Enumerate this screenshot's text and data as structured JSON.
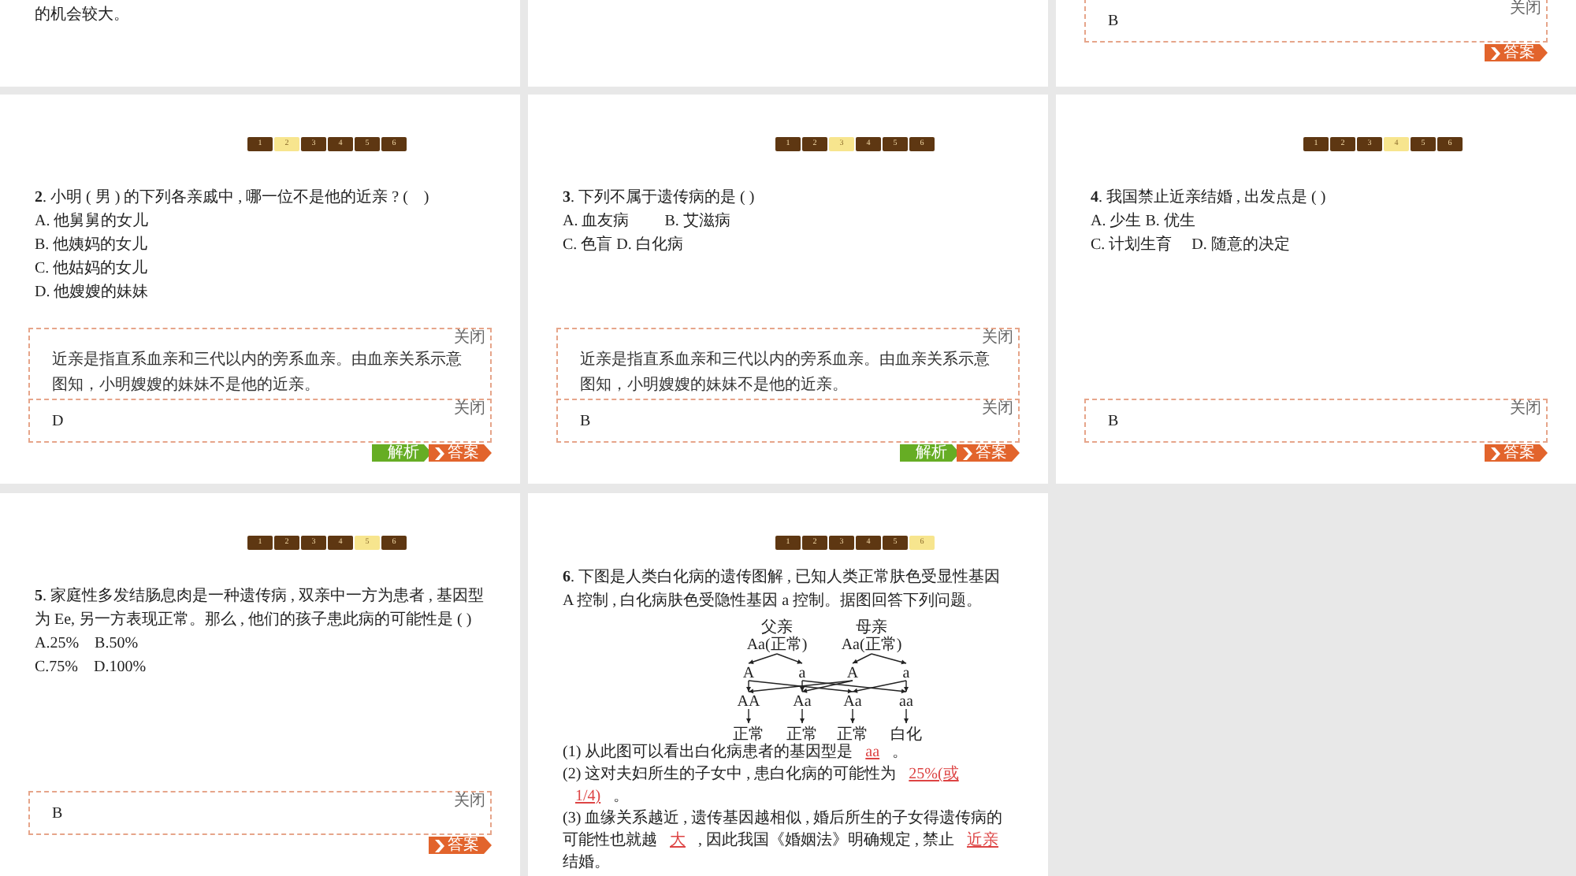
{
  "top_row": [
    {
      "kind": "text",
      "text": "的机会较大。"
    },
    {
      "kind": "blank"
    },
    {
      "kind": "answer",
      "answer": {
        "close": "关闭",
        "text": "B"
      },
      "buttons": [
        {
          "kind": "answer",
          "label": "答案"
        }
      ]
    }
  ],
  "slides": [
    {
      "pager": [
        {
          "label": "1",
          "selected": false
        },
        {
          "label": "2",
          "selected": true
        },
        {
          "label": "3",
          "selected": false
        },
        {
          "label": "4",
          "selected": false
        },
        {
          "label": "5",
          "selected": false
        },
        {
          "label": "6",
          "selected": false
        }
      ],
      "question": {
        "text": "**2**. 小明 ( 男 ) 的下列各亲戚中 , 哪一位不是他的近亲 ? (　)",
        "options": [
          "A. 他舅舅的女儿",
          "B. 他姨妈的女儿",
          "C. 他姑妈的女儿",
          "D. 他嫂嫂的妹妹"
        ]
      },
      "explanation": {
        "close": "关闭",
        "text": "近亲是指直系血亲和三代以内的旁系血亲。由血亲关系示意图知，小明嫂嫂的妹妹不是他的近亲。"
      },
      "answer": {
        "close": "关闭",
        "text": "D"
      },
      "buttons": [
        {
          "kind": "analysis",
          "label": "解析"
        },
        {
          "kind": "answer",
          "label": "答案"
        }
      ]
    },
    {
      "pager": [
        {
          "label": "1",
          "selected": false
        },
        {
          "label": "2",
          "selected": false
        },
        {
          "label": "3",
          "selected": true
        },
        {
          "label": "4",
          "selected": false
        },
        {
          "label": "5",
          "selected": false
        },
        {
          "label": "6",
          "selected": false
        }
      ],
      "question": {
        "text": "**3**. 下列不属于遗传病的是 (  )",
        "options": [
          "A. 血友病　　 B. 艾滋病",
          "C. 色盲  D. 白化病"
        ]
      },
      "explanation": {
        "close": "关闭",
        "text": "近亲是指直系血亲和三代以内的旁系血亲。由血亲关系示意图知，小明嫂嫂的妹妹不是他的近亲。"
      },
      "answer": {
        "close": "关闭",
        "text": "B"
      },
      "buttons": [
        {
          "kind": "analysis",
          "label": "解析"
        },
        {
          "kind": "answer",
          "label": "答案"
        }
      ]
    },
    {
      "pager": [
        {
          "label": "1",
          "selected": false
        },
        {
          "label": "2",
          "selected": false
        },
        {
          "label": "3",
          "selected": false
        },
        {
          "label": "4",
          "selected": true
        },
        {
          "label": "5",
          "selected": false
        },
        {
          "label": "6",
          "selected": false
        }
      ],
      "question": {
        "text": "**4**. 我国禁止近亲结婚 , 出发点是 (   )",
        "options": [
          "A. 少生  B. 优生",
          "C. 计划生育　  D. 随意的决定"
        ]
      },
      "answer": {
        "close": "关闭",
        "text": "B"
      },
      "buttons": [
        {
          "kind": "answer",
          "label": "答案"
        }
      ]
    },
    {
      "pager": [
        {
          "label": "1",
          "selected": false
        },
        {
          "label": "2",
          "selected": false
        },
        {
          "label": "3",
          "selected": false
        },
        {
          "label": "4",
          "selected": false
        },
        {
          "label": "5",
          "selected": true
        },
        {
          "label": "6",
          "selected": false
        }
      ],
      "question": {
        "text": "**5**. 家庭性多发结肠息肉是一种遗传病 , 双亲中一方为患者 , 基因型为 Ee, 另一方表现正常。那么 , 他们的孩子患此病的可能性是 (   )",
        "options": [
          "A.25%　B.50%",
          "C.75%　D.100%"
        ]
      },
      "answer": {
        "close": "关闭",
        "text": "B"
      },
      "buttons": [
        {
          "kind": "answer",
          "label": "答案"
        }
      ]
    },
    {
      "pager": [
        {
          "label": "1",
          "selected": false
        },
        {
          "label": "2",
          "selected": false
        },
        {
          "label": "3",
          "selected": false
        },
        {
          "label": "4",
          "selected": false
        },
        {
          "label": "5",
          "selected": false
        },
        {
          "label": "6",
          "selected": true
        }
      ],
      "question": {
        "text": "**6**. 下图是人类白化病的遗传图解 , 已知人类正常肤色受显性基因 A 控制 , 白化病肤色受隐性基因 a 控制。据图回答下列问题。",
        "diagram": {
          "parents": [
            {
              "label": "父亲",
              "genotype": "Aa(正常)",
              "gametes": [
                "A",
                "a"
              ]
            },
            {
              "label": "母亲",
              "genotype": "Aa(正常)",
              "gametes": [
                "A",
                "a"
              ]
            }
          ],
          "offspring": [
            {
              "genotype": "AA",
              "phenotype": "正常"
            },
            {
              "genotype": "Aa",
              "phenotype": "正常"
            },
            {
              "genotype": "Aa",
              "phenotype": "正常"
            },
            {
              "genotype": "aa",
              "phenotype": "白化"
            }
          ]
        },
        "subquestions": [
          [
            {
              "kind": "text",
              "text": "(1) 从此图可以看出白化病患者的基因型是"
            },
            {
              "kind": "blank",
              "text": "aa"
            },
            {
              "kind": "text",
              "text": "。"
            }
          ],
          [
            {
              "kind": "text",
              "text": "(2) 这对夫妇所生的子女中 , 患白化病的可能性为"
            },
            {
              "kind": "blank",
              "text": "25%(或"
            },
            {
              "kind": "blank",
              "text": "1/4)"
            },
            {
              "kind": "text",
              "text": "。"
            }
          ],
          [
            {
              "kind": "text",
              "text": "(3) 血缘关系越近 , 遗传基因越相似 , 婚后所生的子女得遗传病的可能性也就越"
            },
            {
              "kind": "blank",
              "text": "大"
            },
            {
              "kind": "text",
              "text": ", 因此我国《婚姻法》明确规定 , 禁止"
            },
            {
              "kind": "blank",
              "text": "近亲"
            },
            {
              "kind": "text",
              "text": "结婚。"
            }
          ]
        ]
      }
    }
  ]
}
